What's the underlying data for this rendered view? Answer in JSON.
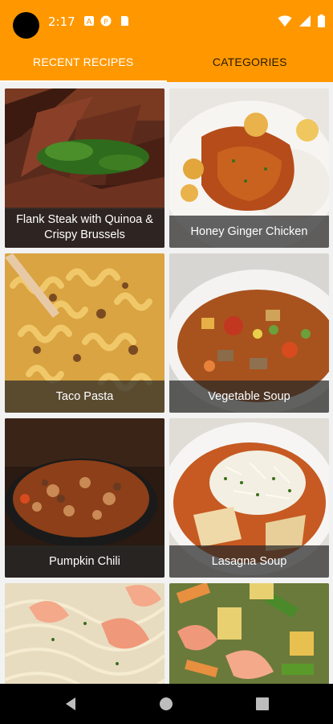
{
  "status_bar": {
    "time": "2:17",
    "icons": [
      "notification-a-icon",
      "notification-p-icon",
      "sd-card-icon",
      "wifi-icon",
      "signal-icon",
      "battery-icon"
    ]
  },
  "tabs": [
    {
      "label": "RECENT RECIPES",
      "active": true
    },
    {
      "label": "CATEGORIES",
      "active": false
    }
  ],
  "recipes": [
    {
      "name": "Flank Steak with Quinoa & Crispy Brussels"
    },
    {
      "name": "Honey Ginger Chicken"
    },
    {
      "name": "Taco Pasta"
    },
    {
      "name": "Vegetable Soup"
    },
    {
      "name": "Pumpkin Chili"
    },
    {
      "name": "Lasagna Soup"
    },
    {
      "name": ""
    },
    {
      "name": ""
    }
  ],
  "nav_bar": {
    "buttons": [
      "back-icon",
      "home-icon",
      "recents-icon"
    ]
  },
  "colors": {
    "app_bar": "#ff9800",
    "tab_active_text": "#ffffff",
    "tab_inactive_text": "#2a1a00",
    "label_overlay": "#282828"
  }
}
